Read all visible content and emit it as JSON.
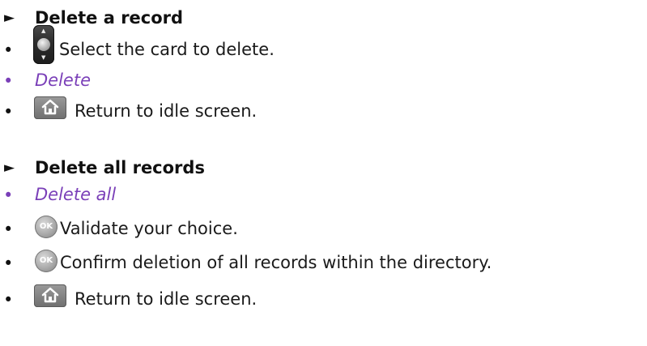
{
  "section_delete_record": {
    "heading": "Delete a record",
    "items": [
      {
        "icon": "navigation-up-down-key-icon",
        "text": "Select the card to delete."
      },
      {
        "menu": "Delete"
      },
      {
        "icon": "home-key-icon",
        "text": "Return to idle screen."
      }
    ]
  },
  "section_delete_all": {
    "heading": "Delete all records",
    "items": [
      {
        "menu": "Delete all"
      },
      {
        "icon": "ok-key-icon",
        "text": "Validate your choice."
      },
      {
        "icon": "ok-key-icon",
        "text": "Confirm deletion of all records within the directory."
      },
      {
        "icon": "home-key-icon",
        "text": "Return to idle screen."
      }
    ]
  },
  "icons": {
    "arrow": "►",
    "bullet": "•",
    "ok_label": "OK"
  },
  "colors": {
    "menu_text": "#7a3fb8",
    "body_text": "#1a1a1a"
  }
}
